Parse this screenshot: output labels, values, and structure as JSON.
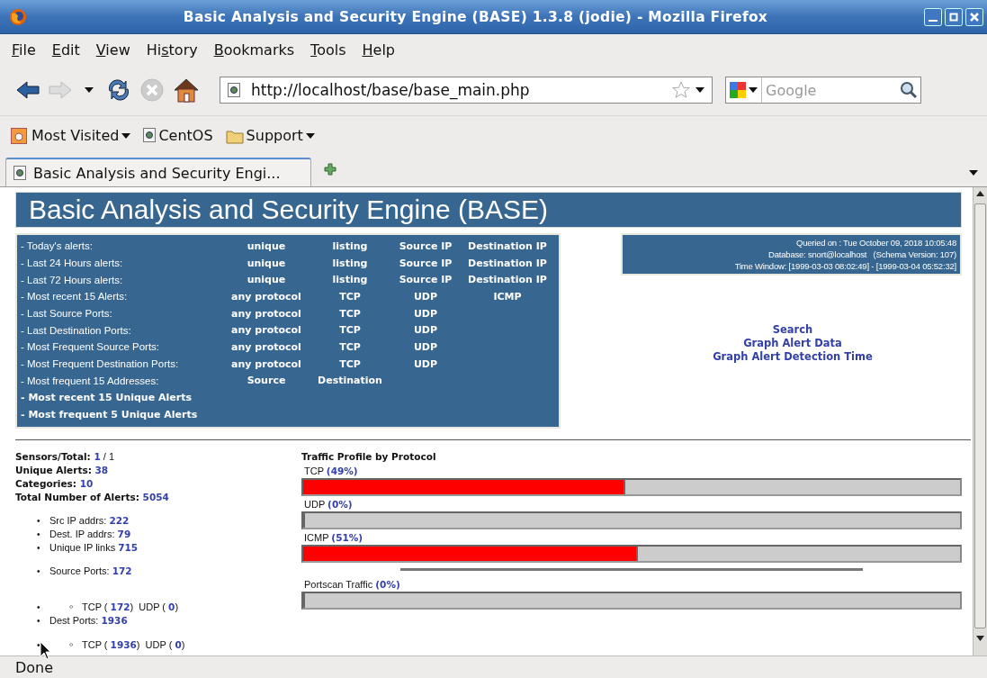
{
  "window": {
    "title": "Basic Analysis and Security Engine (BASE) 1.3.8 (jodie) - Mozilla Firefox"
  },
  "menu": [
    {
      "key": "F",
      "rest": "ile"
    },
    {
      "key": "E",
      "rest": "dit"
    },
    {
      "key": "V",
      "rest": "iew"
    },
    {
      "before": "Hi",
      "key": "s",
      "rest": "tory"
    },
    {
      "key": "B",
      "rest": "ookmarks"
    },
    {
      "key": "T",
      "rest": "ools"
    },
    {
      "key": "H",
      "rest": "elp"
    }
  ],
  "toolbar": {
    "url": "http://localhost/base/base_main.php",
    "search_placeholder": "Google"
  },
  "bookmarks": [
    {
      "label": "Most Visited",
      "has_menu": true
    },
    {
      "label": "CentOS",
      "has_menu": false
    },
    {
      "label": "Support",
      "has_menu": true
    }
  ],
  "tabs": [
    {
      "label": "Basic Analysis and Security Engi...",
      "selected": true
    }
  ],
  "page": {
    "heading": "Basic Analysis and Security Engine (BASE)",
    "menu_rows": [
      {
        "label": "- Today's alerts:",
        "bold": false,
        "links": [
          "unique",
          "listing",
          "Source IP",
          "Destination IP"
        ]
      },
      {
        "label": "- Last 24 Hours alerts:",
        "bold": false,
        "links": [
          "unique",
          "listing",
          "Source IP",
          "Destination IP"
        ]
      },
      {
        "label": "- Last 72 Hours alerts:",
        "bold": false,
        "links": [
          "unique",
          "listing",
          "Source IP",
          "Destination IP"
        ]
      },
      {
        "label": "- Most recent 15 Alerts:",
        "bold": false,
        "links": [
          "any protocol",
          "TCP",
          "UDP",
          "ICMP"
        ]
      },
      {
        "label": "- Last Source Ports:",
        "bold": false,
        "links": [
          "any protocol",
          "TCP",
          "UDP"
        ]
      },
      {
        "label": "- Last Destination Ports:",
        "bold": false,
        "links": [
          "any protocol",
          "TCP",
          "UDP"
        ]
      },
      {
        "label": "- Most Frequent Source Ports:",
        "bold": false,
        "links": [
          "any protocol",
          "TCP",
          "UDP"
        ]
      },
      {
        "label": "- Most Frequent Destination Ports:",
        "bold": false,
        "links": [
          "any protocol",
          "TCP",
          "UDP"
        ]
      },
      {
        "label": "- Most frequent 15 Addresses:",
        "bold": false,
        "links": [
          "Source",
          "Destination"
        ]
      },
      {
        "label": "- Most recent 15 Unique Alerts",
        "bold": true,
        "links": []
      },
      {
        "label": "- Most frequent 5 Unique Alerts",
        "bold": true,
        "links": []
      }
    ],
    "info": [
      "Queried on : Tue October 09, 2018 10:05:48",
      "Database: snort@localhost   (Schema Version: 107)",
      "Time Window: [1999-03-03 08:02:49] - [1999-03-04 05:52:32]"
    ],
    "side_links": [
      "Search",
      "Graph Alert Data",
      "Graph Alert Detection Time"
    ],
    "stats": [
      [
        {
          "kind": "bold",
          "text": "Sensors/Total: "
        },
        {
          "kind": "link",
          "text": "1"
        },
        {
          "kind": "text",
          "text": " / 1"
        }
      ],
      [
        {
          "kind": "bold",
          "text": "Unique Alerts: "
        },
        {
          "kind": "link",
          "text": "38"
        }
      ],
      [
        {
          "kind": "bold",
          "text": "Categories: "
        },
        {
          "kind": "link",
          "text": "10"
        }
      ],
      [
        {
          "kind": "bold",
          "text": "Total Number of Alerts: "
        },
        {
          "kind": "link",
          "text": "5054"
        }
      ]
    ],
    "ip_list": [
      {
        "marker": "•",
        "parts": [
          {
            "kind": "text",
            "text": "Src IP addrs: "
          },
          {
            "kind": "link",
            "text": "222"
          }
        ]
      },
      {
        "marker": "•",
        "parts": [
          {
            "kind": "text",
            "text": "Dest. IP addrs: "
          },
          {
            "kind": "link",
            "text": "79"
          }
        ]
      },
      {
        "marker": "•",
        "parts": [
          {
            "kind": "text",
            "text": "Unique IP links "
          },
          {
            "kind": "link",
            "text": "715"
          }
        ]
      }
    ],
    "port_list": [
      {
        "marker": "•",
        "parts": [
          {
            "kind": "text",
            "text": "Source Ports: "
          },
          {
            "kind": "link",
            "text": "172"
          }
        ]
      },
      {
        "marker": "•",
        "children": [
          {
            "marker": "◦",
            "parts": [
              {
                "kind": "text",
                "text": "TCP ( "
              },
              {
                "kind": "link",
                "text": "172"
              },
              {
                "kind": "text",
                "text": ")  UDP ( "
              },
              {
                "kind": "link",
                "text": "0"
              },
              {
                "kind": "text",
                "text": ")"
              }
            ]
          }
        ]
      },
      {
        "marker": "•",
        "parts": [
          {
            "kind": "text",
            "text": "Dest Ports: "
          },
          {
            "kind": "link",
            "text": "1936"
          }
        ]
      },
      {
        "marker": "•",
        "children": [
          {
            "marker": "◦",
            "parts": [
              {
                "kind": "text",
                "text": "TCP ( "
              },
              {
                "kind": "link",
                "text": "1936"
              },
              {
                "kind": "text",
                "text": ")  UDP ( "
              },
              {
                "kind": "link",
                "text": "0"
              },
              {
                "kind": "text",
                "text": ")"
              }
            ]
          }
        ]
      }
    ],
    "traffic": {
      "title": "Traffic Profile by Protocol",
      "bars": [
        {
          "label": "TCP",
          "value": "(49%)",
          "level": 0.49
        },
        {
          "label": "UDP",
          "value": "(0%)",
          "level": 0
        },
        {
          "label": "ICMP",
          "value": "(51%)",
          "level": 0.51
        }
      ],
      "portscan": {
        "label": "Portscan Traffic",
        "value": "(0%)",
        "level": 0
      }
    }
  },
  "status_bar": "Done"
}
